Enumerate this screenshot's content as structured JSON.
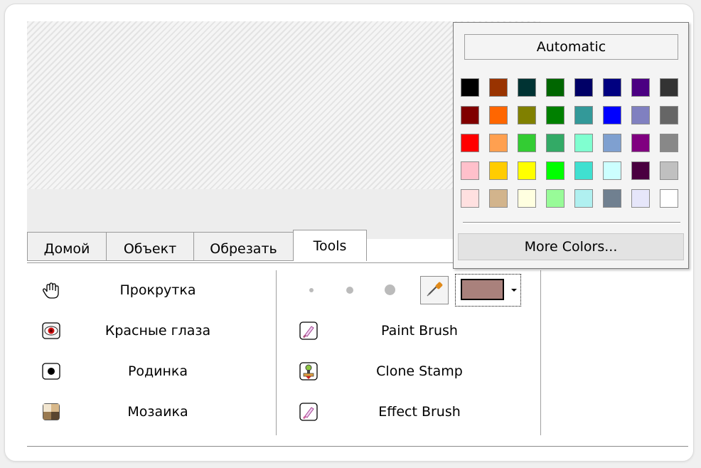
{
  "tabs": [
    {
      "label": "Домой"
    },
    {
      "label": "Объект"
    },
    {
      "label": "Обрезать"
    },
    {
      "label": "Tools"
    }
  ],
  "tools_left": [
    {
      "label": "Прокрутка",
      "icon": "hand-icon"
    },
    {
      "label": "Красные глаза",
      "icon": "red-eye-icon"
    },
    {
      "label": "Родинка",
      "icon": "mole-icon"
    },
    {
      "label": "Мозаика",
      "icon": "mosaic-icon"
    }
  ],
  "tools_right": [
    {
      "label": "Paint Brush",
      "icon": "paint-brush-icon"
    },
    {
      "label": "Clone Stamp",
      "icon": "clone-stamp-icon"
    },
    {
      "label": "Effect Brush",
      "icon": "effect-brush-icon"
    }
  ],
  "current_color": "#a9817c",
  "color_popup": {
    "automatic_label": "Automatic",
    "more_colors_label": "More Colors...",
    "palette": [
      [
        "#000000",
        "#993300",
        "#003333",
        "#006600",
        "#000066",
        "#000080",
        "#4b0082",
        "#333333"
      ],
      [
        "#800000",
        "#ff6600",
        "#808000",
        "#008000",
        "#339999",
        "#0000ff",
        "#8080c0",
        "#666666"
      ],
      [
        "#ff0000",
        "#ffa050",
        "#33cc33",
        "#33aa66",
        "#80ffd0",
        "#7fa0d0",
        "#800080",
        "#888888"
      ],
      [
        "#ffc0cb",
        "#ffcc00",
        "#ffff00",
        "#00ff00",
        "#40e0d0",
        "#ccffff",
        "#4a0040",
        "#c0c0c0"
      ],
      [
        "#ffe0e0",
        "#d2b48c",
        "#ffffe0",
        "#98fb98",
        "#b0f0f0",
        "#708090",
        "#e6e6fa",
        "#ffffff"
      ]
    ]
  }
}
